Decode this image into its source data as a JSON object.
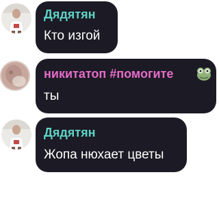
{
  "messages": [
    {
      "author": "Дядятян",
      "text": "Кто изгой",
      "name_color": "#5fd3c6",
      "avatar": "person-white-shirt-avatar"
    },
    {
      "author": "никитатоп #помогите",
      "text": "ты",
      "name_color": "#e46cc8",
      "avatar": "blurred-face-avatar",
      "badge_icon": "frog-sticker-icon"
    },
    {
      "author": "Дядятян",
      "text": "Жопа нюхает цветы",
      "name_color": "#5fd3c6",
      "avatar": "person-white-shirt-avatar"
    }
  ]
}
